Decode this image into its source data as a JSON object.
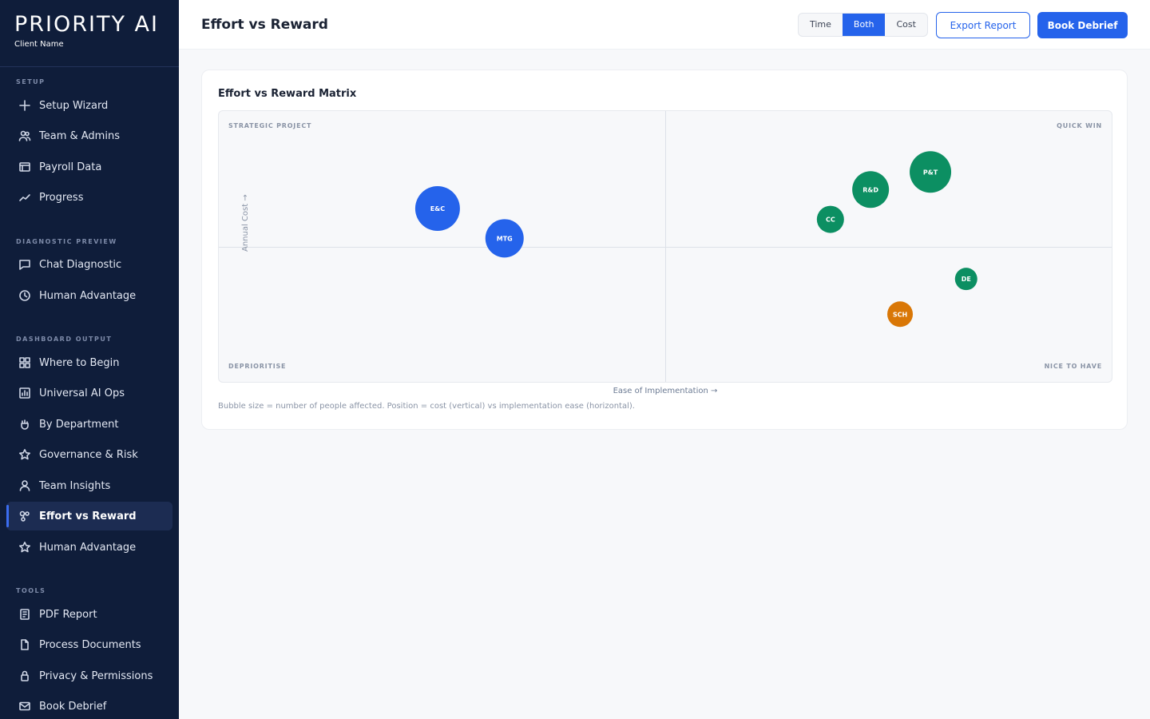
{
  "brand": {
    "title": "PRIORITY AI",
    "client": "Client Name"
  },
  "sidebar": {
    "sections": [
      {
        "label": "SETUP",
        "items": [
          {
            "label": "Setup Wizard",
            "icon": "plus-icon"
          },
          {
            "label": "Team & Admins",
            "icon": "users-icon"
          },
          {
            "label": "Payroll Data",
            "icon": "table-icon"
          },
          {
            "label": "Progress",
            "icon": "trend-icon"
          }
        ]
      },
      {
        "label": "DIAGNOSTIC PREVIEW",
        "items": [
          {
            "label": "Chat Diagnostic",
            "icon": "chat-icon"
          },
          {
            "label": "Human Advantage",
            "icon": "clock-icon"
          }
        ]
      },
      {
        "label": "DASHBOARD OUTPUT",
        "items": [
          {
            "label": "Where to Begin",
            "icon": "grid-icon"
          },
          {
            "label": "Universal AI Ops",
            "icon": "chart-icon"
          },
          {
            "label": "By Department",
            "icon": "hand-icon"
          },
          {
            "label": "Governance & Risk",
            "icon": "star-icon"
          },
          {
            "label": "Team Insights",
            "icon": "user-icon"
          },
          {
            "label": "Effort vs Reward",
            "icon": "nodes-icon",
            "active": true
          },
          {
            "label": "Human Advantage",
            "icon": "star-icon"
          }
        ]
      },
      {
        "label": "TOOLS",
        "items": [
          {
            "label": "PDF Report",
            "icon": "report-icon"
          },
          {
            "label": "Process Documents",
            "icon": "document-icon"
          },
          {
            "label": "Privacy & Permissions",
            "icon": "lock-icon"
          },
          {
            "label": "Book Debrief",
            "icon": "mail-icon"
          }
        ]
      }
    ]
  },
  "header": {
    "title": "Effort vs Reward",
    "toggle": [
      "Time",
      "Both",
      "Cost"
    ],
    "toggle_selected": "Both",
    "export_label": "Export Report",
    "book_label": "Book Debrief"
  },
  "card": {
    "title": "Effort vs Reward Matrix",
    "quadrants": {
      "top_left": "STRATEGIC PROJECT",
      "top_right": "QUICK WIN",
      "bottom_left": "DEPRIORITISE",
      "bottom_right": "NICE TO HAVE"
    },
    "footnote": "Bubble size = number of people affected. Position = cost (vertical) vs implementation ease (horizontal)."
  },
  "chart_data": {
    "type": "scatter",
    "xlabel": "Ease of Implementation →",
    "ylabel": "Annual Cost →",
    "xlim": [
      0,
      100
    ],
    "ylim": [
      0,
      100
    ],
    "colors": {
      "blue": "#2563eb",
      "green": "#0c8f62",
      "orange": "#d97706"
    },
    "points": [
      {
        "label": "E&C",
        "x": 24.5,
        "y": 64,
        "size": 28,
        "color": "blue"
      },
      {
        "label": "MTG",
        "x": 32,
        "y": 53,
        "size": 24,
        "color": "blue"
      },
      {
        "label": "CC",
        "x": 68.5,
        "y": 60,
        "size": 17,
        "color": "green"
      },
      {
        "label": "R&D",
        "x": 73,
        "y": 71,
        "size": 23,
        "color": "green"
      },
      {
        "label": "P&T",
        "x": 79.7,
        "y": 77.5,
        "size": 26,
        "color": "green"
      },
      {
        "label": "DE",
        "x": 83.7,
        "y": 38,
        "size": 14,
        "color": "green"
      },
      {
        "label": "SCH",
        "x": 76.3,
        "y": 25,
        "size": 16,
        "color": "orange"
      }
    ]
  }
}
